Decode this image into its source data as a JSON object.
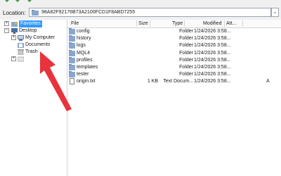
{
  "location": {
    "label": "Location:",
    "value": "98A82F92176B73A2100FCD1F8ABD7255"
  },
  "tree": {
    "items": [
      {
        "label": "Favorites",
        "icon": "star-folder-icon"
      },
      {
        "label": "Desktop",
        "icon": "desktop-icon"
      },
      {
        "label": "My Computer",
        "icon": "computer-icon"
      },
      {
        "label": "Documents",
        "icon": "documents-folder-icon"
      },
      {
        "label": "Trash",
        "icon": "trash-icon"
      }
    ]
  },
  "columns": {
    "file": "File",
    "size": "Size",
    "type": "Type",
    "modified": "Modified",
    "attr": "Att..."
  },
  "files": [
    {
      "name": "config",
      "size": "",
      "type": "Folder",
      "modified": "1/24/2026 3:58...",
      "attr": "",
      "icon": "folder-icon"
    },
    {
      "name": "history",
      "size": "",
      "type": "Folder",
      "modified": "1/24/2026 3:58...",
      "attr": "",
      "icon": "folder-icon"
    },
    {
      "name": "logs",
      "size": "",
      "type": "Folder",
      "modified": "1/24/2026 3:58...",
      "attr": "",
      "icon": "folder-icon"
    },
    {
      "name": "MQL4",
      "size": "",
      "type": "Folder",
      "modified": "1/24/2026 3:58...",
      "attr": "",
      "icon": "folder-icon"
    },
    {
      "name": "profiles",
      "size": "",
      "type": "Folder",
      "modified": "1/24/2026 3:58...",
      "attr": "",
      "icon": "folder-icon"
    },
    {
      "name": "templates",
      "size": "",
      "type": "Folder",
      "modified": "1/24/2026 3:58...",
      "attr": "",
      "icon": "folder-icon"
    },
    {
      "name": "tester",
      "size": "",
      "type": "Folder",
      "modified": "1/24/2026 3:58...",
      "attr": "",
      "icon": "folder-icon"
    },
    {
      "name": "origin.txt",
      "size": "1 KB",
      "type": "Text Docum...",
      "modified": "1/24/2026 3:58...",
      "attr": "A",
      "icon": "text-file-icon"
    }
  ],
  "colors": {
    "selection": "#3399ff",
    "folder": "#8aa6cf",
    "arrow": "#e8323c",
    "nav_green": "#3a9a3a"
  }
}
